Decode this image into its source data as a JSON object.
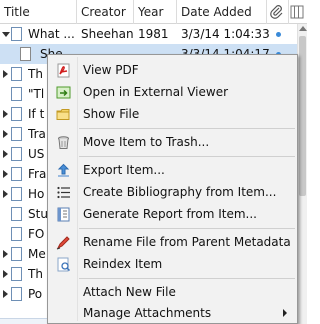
{
  "columns": {
    "title": "Title",
    "creator": "Creator",
    "year": "Year",
    "date_added": "Date Added",
    "attachment_icon": "paperclip-icon",
    "column_picker_icon": "column-picker-icon"
  },
  "rows": [
    {
      "title": "What ...",
      "creator": "Sheehan",
      "year": "1981",
      "date_added": "3/3/14 1:04:33",
      "has_dot": true,
      "type": "parent",
      "open": true
    },
    {
      "title": "She...",
      "creator": "",
      "year": "",
      "date_added": "3/3/14 1:04:17",
      "has_dot": true,
      "type": "child",
      "selected": true
    },
    {
      "title": "Th",
      "type": "parent"
    },
    {
      "title": "\"Tl",
      "type": "note"
    },
    {
      "title": "If t",
      "type": "parent"
    },
    {
      "title": "Tra",
      "type": "parent"
    },
    {
      "title": "US",
      "type": "parent"
    },
    {
      "title": "Fra",
      "type": "parent"
    },
    {
      "title": "Ho",
      "type": "parent"
    },
    {
      "title": "Stu",
      "type": "note"
    },
    {
      "title": "FO",
      "type": "note"
    },
    {
      "title": "Me",
      "type": "parent"
    },
    {
      "title": "Th",
      "type": "parent"
    },
    {
      "title": "Po",
      "type": "parent"
    }
  ],
  "context_menu": {
    "view_pdf": {
      "label": "View PDF",
      "icon": "pdf-icon"
    },
    "open_external": {
      "label": "Open in External Viewer",
      "icon": "open-external-icon"
    },
    "show_file": {
      "label": "Show File",
      "icon": "folder-icon"
    },
    "move_to_trash": {
      "label": "Move Item to Trash...",
      "icon": "trash-icon"
    },
    "export_item": {
      "label": "Export Item...",
      "icon": "export-icon"
    },
    "create_bibliography": {
      "label": "Create Bibliography from Item...",
      "icon": "bibliography-icon"
    },
    "generate_report": {
      "label": "Generate Report from Item...",
      "icon": "report-icon"
    },
    "rename_file": {
      "label": "Rename File from Parent Metadata",
      "icon": "rename-icon"
    },
    "reindex_item": {
      "label": "Reindex Item",
      "icon": "reindex-icon"
    },
    "attach_new_file": {
      "label": "Attach New File"
    },
    "manage_attachments": {
      "label": "Manage Attachments",
      "icon": "submenu-arrow-icon"
    }
  },
  "colors": {
    "selection": "#cde0f4",
    "menu_bg": "#f2f2f2",
    "dot": "#3a8ad8"
  }
}
